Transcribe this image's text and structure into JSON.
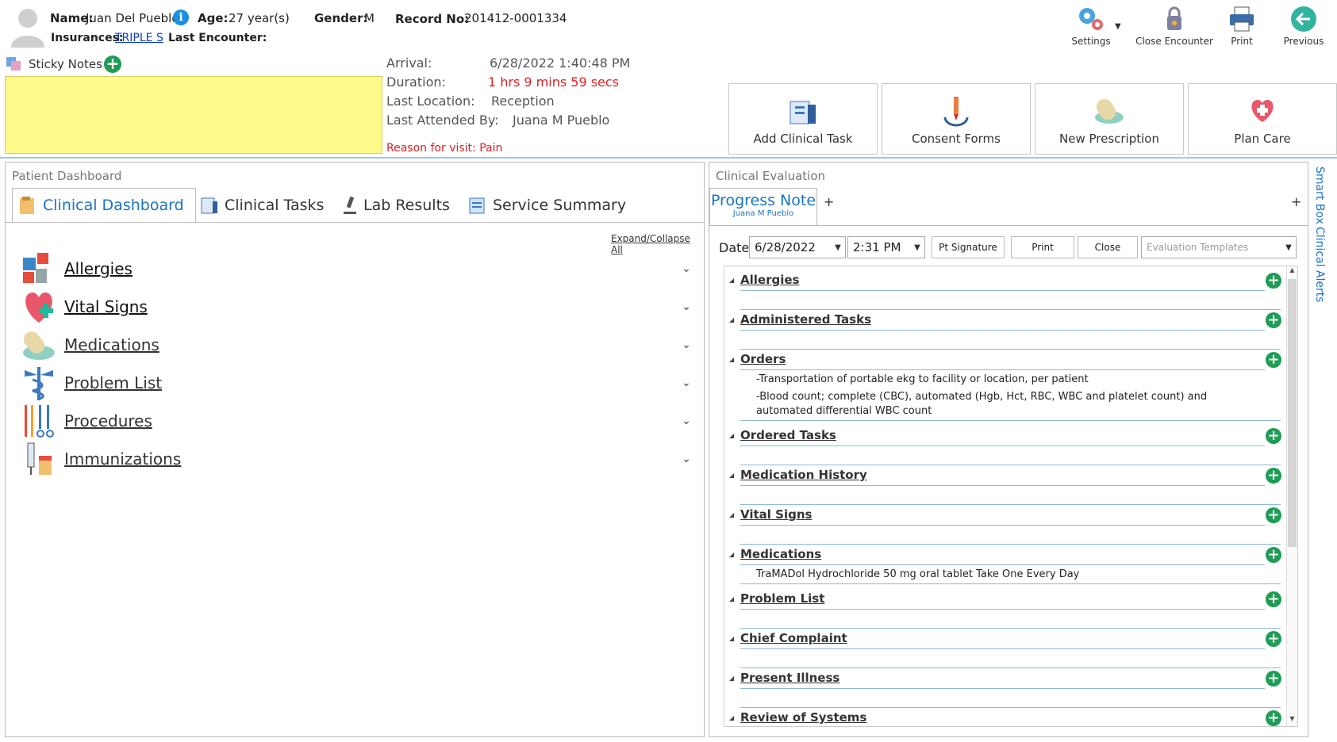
{
  "patient": {
    "name_label": "Name:",
    "name": "Juan Del Pueblo",
    "age_label": "Age:",
    "age": "27 year(s)",
    "gender_label": "Gender:",
    "gender": "M",
    "record_label": "Record No:",
    "record": "201412-0001334",
    "insurances_label": "Insurances:",
    "insurance": "TRIPLE S",
    "last_encounter_label": "Last Encounter:",
    "last_encounter": ""
  },
  "toolbar": {
    "settings": "Settings",
    "close_encounter": "Close Encounter",
    "print": "Print",
    "previous": "Previous"
  },
  "sticky": {
    "label": "Sticky Notes",
    "color": "#fff98a"
  },
  "visit": {
    "arrival_label": "Arrival:",
    "arrival": "6/28/2022 1:40:48 PM",
    "duration_label": "Duration:",
    "duration": "1 hrs 9 mins 59 secs",
    "location_label": "Last Location:",
    "location": "Reception",
    "attended_label": "Last Attended By:",
    "attended": "Juana M Pueblo",
    "reason": "Reason for visit: Pain"
  },
  "actions": {
    "add_task": "Add Clinical Task",
    "consent": "Consent Forms",
    "prescription": "New Prescription",
    "plan_care": "Plan Care"
  },
  "left": {
    "title": "Patient Dashboard",
    "tabs": [
      "Clinical Dashboard",
      "Clinical Tasks",
      "Lab Results",
      "Service Summary"
    ],
    "expand_all": "Expand/Collapse All",
    "items": [
      "Allergies",
      "Vital Signs",
      "Medications",
      "Problem List",
      "Procedures",
      "Immunizations"
    ]
  },
  "right": {
    "title": "Clinical Evaluation",
    "tab": "Progress Note",
    "tab_sub": "Juana M Pueblo",
    "add_tab": "+",
    "date_label": "Date:",
    "date": "6/28/2022",
    "time": "2:31 PM",
    "pt_signature": "Pt Signature",
    "print": "Print",
    "close": "Close",
    "templates_placeholder": "Evaluation Templates",
    "sections": [
      {
        "name": "Allergies",
        "items": []
      },
      {
        "name": "Administered Tasks",
        "items": []
      },
      {
        "name": "Orders",
        "items": [
          "-Transportation of portable ekg to facility or location, per patient",
          "-Blood count; complete (CBC), automated (Hgb, Hct, RBC, WBC and platelet count) and automated differential WBC count"
        ]
      },
      {
        "name": "Ordered Tasks",
        "items": []
      },
      {
        "name": "Medication History",
        "items": []
      },
      {
        "name": "Vital Signs",
        "items": []
      },
      {
        "name": "Medications",
        "items": [
          "TraMADol Hydrochloride 50 mg oral tablet Take One Every Day"
        ]
      },
      {
        "name": "Problem List",
        "items": []
      },
      {
        "name": "Chief Complaint",
        "items": []
      },
      {
        "name": "Present Illness",
        "items": []
      },
      {
        "name": "Review of Systems",
        "items": []
      }
    ]
  },
  "side_tabs": [
    "Smart Box",
    "Clinical Alerts"
  ]
}
